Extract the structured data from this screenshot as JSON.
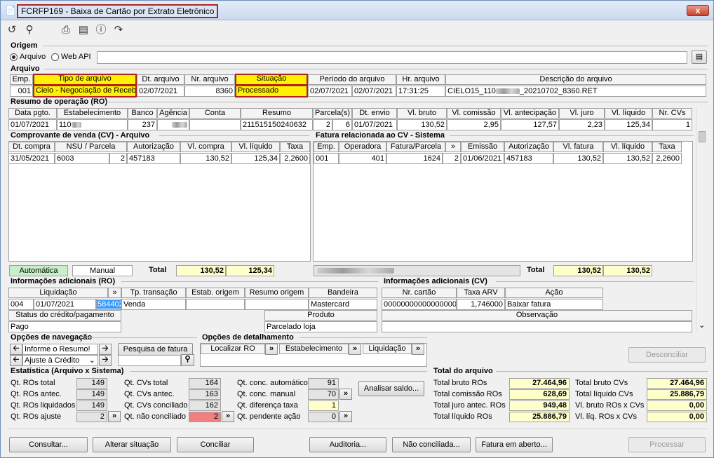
{
  "window": {
    "title": "FCRFP169 - Baixa de Cartão por Extrato Eletrônico",
    "close": "x"
  },
  "origem": {
    "label": "Origem",
    "opt1": "Arquivo",
    "opt2": "Web API",
    "selected": "Arquivo",
    "path": ""
  },
  "arquivo": {
    "label": "Arquivo",
    "headers": [
      "Emp.",
      "Tipo de arquivo",
      "Dt. arquivo",
      "Nr. arquivo",
      "Situação",
      "Período do arquivo",
      "Hr. arquivo",
      "Descrição do arquivo"
    ],
    "row": {
      "emp": "001",
      "tipo": "Cielo - Negociação de Recebi",
      "dt": "02/07/2021",
      "nr": "8360",
      "situacao": "Processado",
      "periodo_ini": "02/07/2021",
      "periodo_fim": "02/07/2021",
      "hr": "17:31:25",
      "desc_a": "CIELO15_110",
      "desc_b": "_20210702_8360.RET"
    }
  },
  "resumo": {
    "label": "Resumo de operação (RO)",
    "headers": [
      "Data pgto.",
      "Estabelecimento",
      "Banco",
      "Agência",
      "Conta",
      "Resumo",
      "Parcela(s)",
      "Dt. envio",
      "Vl. bruto",
      "Vl. comissão",
      "Vl. antecipação",
      "Vl. juro",
      "Vl. líquido",
      "Nr. CVs"
    ],
    "row": {
      "data": "01/07/2021",
      "estab": "110",
      "banco": "237",
      "agencia": "",
      "conta": "",
      "resumo": "211515150240632",
      "parcela_a": "2",
      "parcela_b": "6",
      "envio": "01/07/2021",
      "bruto": "130,52",
      "comissao": "2,95",
      "antecip": "127,57",
      "juro": "2,23",
      "liquido": "125,34",
      "ncvs": "1"
    }
  },
  "cv": {
    "label": "Comprovante de venda (CV) - Arquivo",
    "headers": [
      "Dt. compra",
      "NSU / Parcela",
      "Autorização",
      "Vl. compra",
      "Vl. líquido",
      "Taxa"
    ],
    "row": {
      "dt": "31/05/2021",
      "nsu": "6003",
      "parcela": "2",
      "aut": "457183",
      "compra": "130,52",
      "liquido": "125,34",
      "taxa": "2,2600"
    },
    "auto_label": "Automática",
    "manual_label": "Manual",
    "total_label": "Total",
    "total_compra": "130,52",
    "total_liq": "125,34"
  },
  "fatura": {
    "label": "Fatura relacionada ao CV - Sistema",
    "headers": [
      "Emp.",
      "Operadora",
      "Fatura/Parcela",
      "»",
      "Emissão",
      "Autorização",
      "Vl. fatura",
      "Vl. líquido",
      "Taxa"
    ],
    "row": {
      "emp": "001",
      "operadora": "401",
      "fatura": "1624",
      "parcela": "2",
      "emissao": "01/06/2021",
      "aut": "457183",
      "vfat": "130,52",
      "vliq": "130,52",
      "taxa": "2,2600"
    },
    "total_label": "Total",
    "total_fat": "130,52",
    "total_liq": "130,52"
  },
  "info_ro": {
    "label": "Informações adicionais (RO)",
    "headers": [
      "Liquidação",
      "»",
      "Tp. transação",
      "Estab. origem",
      "Resumo origem",
      "Bandeira"
    ],
    "row": {
      "cod": "004",
      "data": "01/07/2021",
      "num": "584402",
      "tp": "Venda",
      "bandeira": "Mastercard"
    },
    "status_label": "Status do crédito/pagamento",
    "status": "Pago",
    "produto_label": "Produto",
    "produto": "Parcelado loja"
  },
  "info_cv": {
    "label": "Informações adicionais (CV)",
    "headers": [
      "Nr. cartão",
      "Taxa ARV",
      "Ação"
    ],
    "row": {
      "cartao": "00000000000000000",
      "taxa": "1,746000",
      "acao": "Baixar fatura"
    },
    "obs_label": "Observação"
  },
  "nav": {
    "label": "Opções de navegação",
    "sel1": "Informe o Resumo!",
    "sel2": "Ajuste à Crédito",
    "pesquisa": "Pesquisa de fatura"
  },
  "detal": {
    "label": "Opções de detalhamento",
    "b1": "Localizar RO",
    "b2": "Estabelecimento",
    "b3": "Liquidação"
  },
  "desconciliar": "Desconciliar",
  "estat": {
    "label": "Estatística (Arquivo x Sistema)",
    "c1": [
      {
        "l": "Qt. ROs total",
        "v": "149"
      },
      {
        "l": "Qt. ROs antec.",
        "v": "149"
      },
      {
        "l": "Qt. ROs liquidados",
        "v": "149"
      },
      {
        "l": "Qt. ROs ajuste",
        "v": "2"
      }
    ],
    "c2": [
      {
        "l": "Qt. CVs total",
        "v": "164"
      },
      {
        "l": "Qt. CVs antec.",
        "v": "163"
      },
      {
        "l": "Qt. CVs conciliado",
        "v": "162"
      },
      {
        "l": "Qt. não conciliado",
        "v": "2"
      }
    ],
    "c3": [
      {
        "l": "Qt. conc. automático",
        "v": "91"
      },
      {
        "l": "Qt. conc. manual",
        "v": "70"
      },
      {
        "l": "Qt. diferença taxa",
        "v": "1"
      },
      {
        "l": "Qt. pendente ação",
        "v": "0"
      }
    ],
    "analisar": "Analisar saldo..."
  },
  "total_arq": {
    "label": "Total do arquivo",
    "left": [
      {
        "l": "Total bruto ROs",
        "v": "27.464,96"
      },
      {
        "l": "Total comissão ROs",
        "v": "628,69"
      },
      {
        "l": "Total juro antec. ROs",
        "v": "949,48"
      },
      {
        "l": "Total líquido ROs",
        "v": "25.886,79"
      }
    ],
    "right": [
      {
        "l": "Total bruto CVs",
        "v": "27.464,96"
      },
      {
        "l": "Total líquido CVs",
        "v": "25.886,79"
      },
      {
        "l": "Vl. bruto ROs x CVs",
        "v": "0,00"
      },
      {
        "l": "Vl. líq. ROs x CVs",
        "v": "0,00"
      }
    ]
  },
  "bottom": {
    "consultar": "Consultar...",
    "alterar": "Alterar situação",
    "conciliar": "Conciliar",
    "auditoria": "Auditoria...",
    "nao_conc": "Não conciliada...",
    "fatura_aberto": "Fatura em aberto...",
    "processar": "Processar"
  },
  "colors": {
    "highlight": "#fff200",
    "border_red": "#b22222",
    "auto_green": "#c8f0c8",
    "pink": "#f08080",
    "cream": "#ffffcc"
  }
}
